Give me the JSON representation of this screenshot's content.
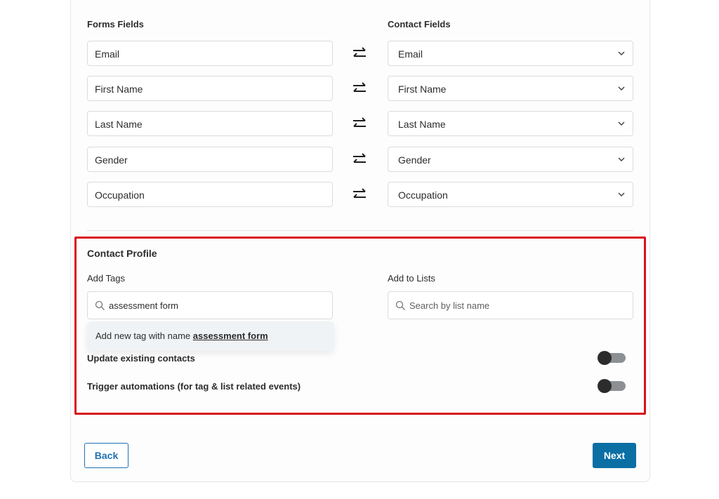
{
  "mapping": {
    "forms_fields_header": "Forms Fields",
    "contact_fields_header": "Contact Fields",
    "rows": [
      {
        "form_field": "Email",
        "contact_field": "Email"
      },
      {
        "form_field": "First Name",
        "contact_field": "First Name"
      },
      {
        "form_field": "Last Name",
        "contact_field": "Last Name"
      },
      {
        "form_field": "Gender",
        "contact_field": "Gender"
      },
      {
        "form_field": "Occupation",
        "contact_field": "Occupation"
      }
    ]
  },
  "contact_profile": {
    "title": "Contact Profile",
    "add_tags_label": "Add Tags",
    "tags_input_value": "assessment form",
    "tag_suggestion_prefix": "Add new tag with name ",
    "tag_suggestion_name": "assessment form",
    "add_lists_label": "Add to Lists",
    "lists_placeholder": "Search by list name",
    "toggles": [
      {
        "label": "Update existing contacts",
        "enabled": false
      },
      {
        "label": "Trigger automations (for tag & list related events)",
        "enabled": false
      }
    ],
    "highlight_color": "#d8121b"
  },
  "footer": {
    "back_label": "Back",
    "next_label": "Next",
    "accent_color": "#0b6fa4"
  }
}
